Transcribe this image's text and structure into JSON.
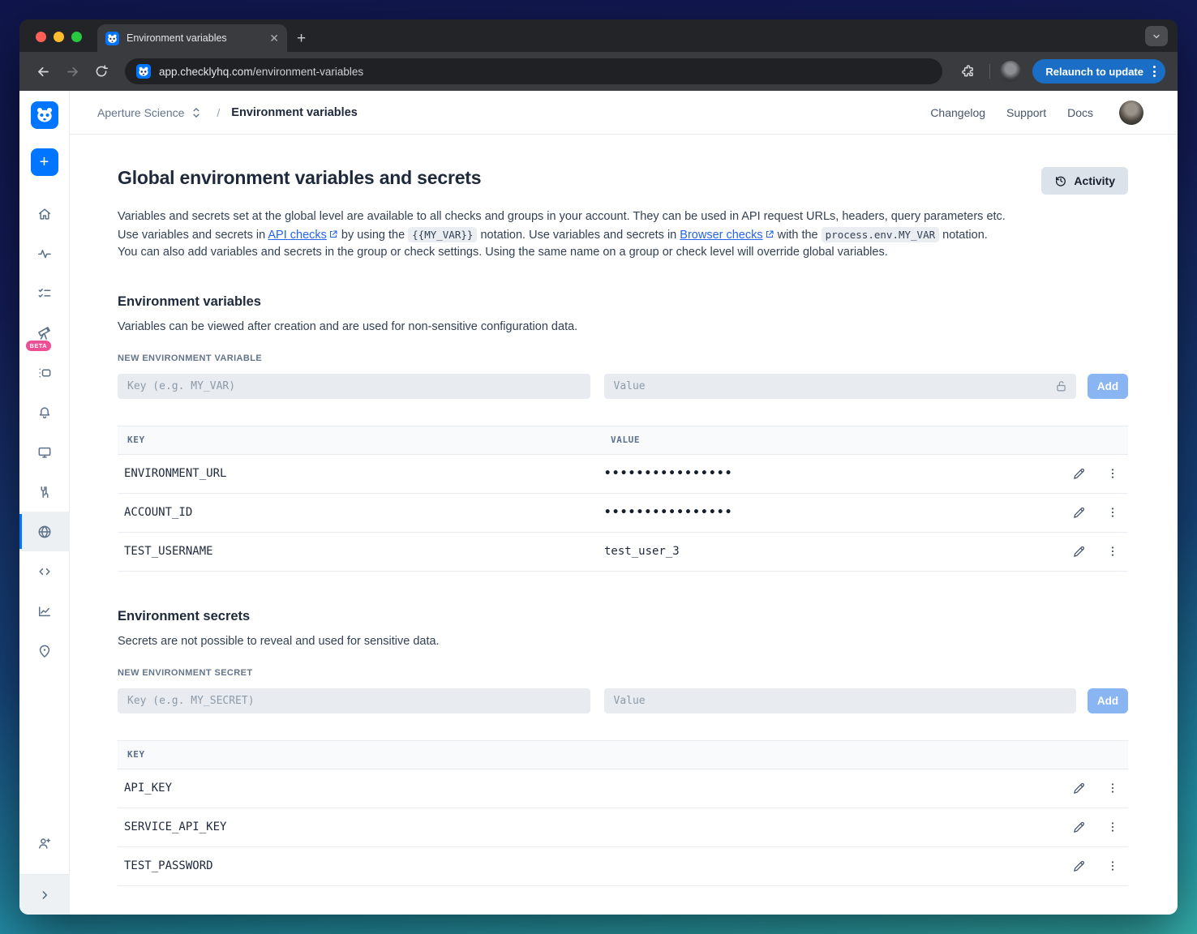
{
  "chrome": {
    "tab_title": "Environment variables",
    "url_domain": "app.checklyhq.com",
    "url_path": "/environment-variables",
    "relaunch_label": "Relaunch to update"
  },
  "topnav": {
    "account": "Aperture Science",
    "separator": "/",
    "page": "Environment variables",
    "links": [
      "Changelog",
      "Support",
      "Docs"
    ]
  },
  "sidebar": {
    "items": [
      "home",
      "activity",
      "checks",
      "explore-beta",
      "test-sessions",
      "alerts",
      "dashboards",
      "maintenance",
      "environment-variables",
      "snippets",
      "analytics",
      "private-locations",
      "invite-user"
    ],
    "active": "environment-variables",
    "beta_label": "BETA"
  },
  "main": {
    "title": "Global environment variables and secrets",
    "activity_label": "Activity",
    "intro_parts": [
      {
        "t": "text",
        "v": "Variables and secrets set at the global level are available to all checks and groups in your account. They can be used in API request URLs, headers, query parameters etc. Use variables and secrets in "
      },
      {
        "t": "link",
        "v": "API checks"
      },
      {
        "t": "text",
        "v": " by using the "
      },
      {
        "t": "code",
        "v": "{{MY_VAR}}"
      },
      {
        "t": "text",
        "v": " notation. Use variables and secrets in "
      },
      {
        "t": "link",
        "v": "Browser checks"
      },
      {
        "t": "text",
        "v": " with the "
      },
      {
        "t": "code",
        "v": "process.env.MY_VAR"
      },
      {
        "t": "text",
        "v": " notation. You can also add variables and secrets in the group or check settings. Using the same name on a group or check level will override global variables."
      }
    ],
    "variables": {
      "heading": "Environment variables",
      "description": "Variables can be viewed after creation and are used for non-sensitive configuration data.",
      "new_label": "NEW ENVIRONMENT VARIABLE",
      "key_placeholder": "Key (e.g. MY_VAR)",
      "value_placeholder": "Value",
      "add_label": "Add",
      "columns": [
        "KEY",
        "VALUE"
      ],
      "rows": [
        {
          "key": "ENVIRONMENT_URL",
          "value": "••••••••••••••••",
          "masked": true
        },
        {
          "key": "ACCOUNT_ID",
          "value": "••••••••••••••••",
          "masked": true
        },
        {
          "key": "TEST_USERNAME",
          "value": "test_user_3",
          "masked": false
        }
      ]
    },
    "secrets": {
      "heading": "Environment secrets",
      "description": "Secrets are not possible to reveal and used for sensitive data.",
      "new_label": "NEW ENVIRONMENT SECRET",
      "key_placeholder": "Key (e.g. MY_SECRET)",
      "value_placeholder": "Value",
      "add_label": "Add",
      "columns": [
        "KEY"
      ],
      "rows": [
        {
          "key": "API_KEY"
        },
        {
          "key": "SERVICE_API_KEY"
        },
        {
          "key": "TEST_PASSWORD"
        }
      ]
    }
  },
  "colors": {
    "brand_blue": "#0075ff",
    "beta_pink": "#ec4f93",
    "add_button_blue": "#8ab5f3",
    "relaunch_blue": "#1a6ec6",
    "link_blue": "#2563eb",
    "bg_gradient_top": "#10164c",
    "bg_gradient_bottom": "#35b2ae"
  }
}
